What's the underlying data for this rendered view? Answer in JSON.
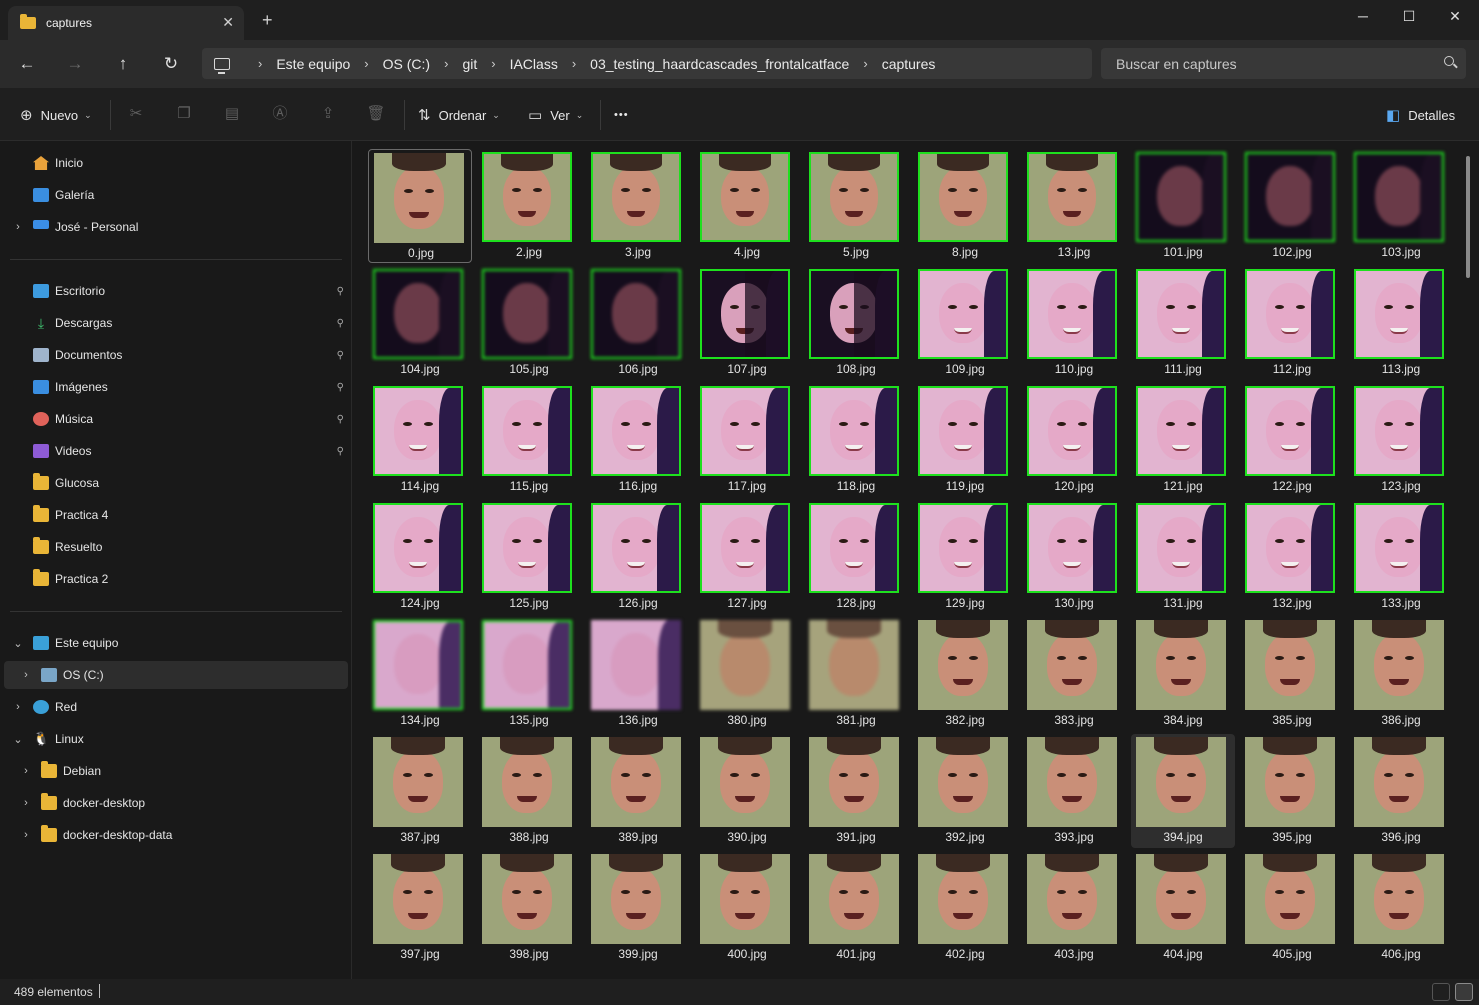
{
  "window": {
    "tab_title": "captures",
    "new_tab": "+",
    "close_tab": "✕",
    "minimize": "─",
    "maximize": "☐",
    "close": "✕"
  },
  "nav": {
    "back": "←",
    "forward": "→",
    "up": "↑",
    "refresh": "↻"
  },
  "breadcrumb": [
    "Este equipo",
    "OS (C:)",
    "git",
    "IAClass",
    "03_testing_haardcascades_frontalcatface",
    "captures"
  ],
  "search": {
    "placeholder": "Buscar en captures"
  },
  "commandbar": {
    "new_label": "Nuevo",
    "sort_label": "Ordenar",
    "view_label": "Ver",
    "more_label": "•••",
    "details_label": "Detalles",
    "icons": [
      "cut-icon",
      "copy-icon",
      "paste-icon",
      "rename-icon",
      "share-icon",
      "delete-icon"
    ]
  },
  "sidebar": {
    "top": [
      {
        "label": "Inicio",
        "icon": "home-icon"
      },
      {
        "label": "Galería",
        "icon": "gallery-icon"
      },
      {
        "label": "José - Personal",
        "icon": "onedrive-icon",
        "expandable": true
      }
    ],
    "quick": [
      {
        "label": "Escritorio",
        "icon": "desktop-icon",
        "pinned": true
      },
      {
        "label": "Descargas",
        "icon": "downloads-icon",
        "pinned": true
      },
      {
        "label": "Documentos",
        "icon": "documents-icon",
        "pinned": true
      },
      {
        "label": "Imágenes",
        "icon": "pictures-icon",
        "pinned": true
      },
      {
        "label": "Música",
        "icon": "music-icon",
        "pinned": true
      },
      {
        "label": "Videos",
        "icon": "videos-icon",
        "pinned": true
      },
      {
        "label": "Glucosa",
        "icon": "folder-icon"
      },
      {
        "label": "Practica 4",
        "icon": "folder-icon"
      },
      {
        "label": "Resuelto",
        "icon": "folder-icon"
      },
      {
        "label": "Practica 2",
        "icon": "folder-icon"
      }
    ],
    "tree": [
      {
        "label": "Este equipo",
        "icon": "pc-icon",
        "expanded": true,
        "level": 0
      },
      {
        "label": "OS (C:)",
        "icon": "drive-icon",
        "level": 1,
        "selected": true
      },
      {
        "label": "Red",
        "icon": "network-icon",
        "level": 0
      },
      {
        "label": "Linux",
        "icon": "linux-icon",
        "expanded": true,
        "level": 0
      },
      {
        "label": "Debian",
        "icon": "folder-icon",
        "level": 1
      },
      {
        "label": "docker-desktop",
        "icon": "folder-icon",
        "level": 1
      },
      {
        "label": "docker-desktop-data",
        "icon": "folder-icon",
        "level": 1
      }
    ],
    "pin_glyph": "📌",
    "expand_glyph": "›",
    "collapse_glyph": "⌄"
  },
  "files": [
    {
      "name": "0.jpg",
      "face": "man",
      "frame": false,
      "focus": true
    },
    {
      "name": "2.jpg",
      "face": "man",
      "frame": true
    },
    {
      "name": "3.jpg",
      "face": "man",
      "frame": true
    },
    {
      "name": "4.jpg",
      "face": "man",
      "frame": true
    },
    {
      "name": "5.jpg",
      "face": "man",
      "frame": true
    },
    {
      "name": "8.jpg",
      "face": "man",
      "frame": true
    },
    {
      "name": "13.jpg",
      "face": "man",
      "frame": true
    },
    {
      "name": "101.jpg",
      "face": "dark",
      "frame": true
    },
    {
      "name": "102.jpg",
      "face": "dark",
      "frame": true
    },
    {
      "name": "103.jpg",
      "face": "dark",
      "frame": true
    },
    {
      "name": "104.jpg",
      "face": "dark",
      "frame": true
    },
    {
      "name": "105.jpg",
      "face": "dark",
      "frame": true
    },
    {
      "name": "106.jpg",
      "face": "dark",
      "frame": true
    },
    {
      "name": "107.jpg",
      "face": "split",
      "frame": true
    },
    {
      "name": "108.jpg",
      "face": "split",
      "frame": true
    },
    {
      "name": "109.jpg",
      "face": "woman",
      "frame": true
    },
    {
      "name": "110.jpg",
      "face": "woman",
      "frame": true
    },
    {
      "name": "111.jpg",
      "face": "woman",
      "frame": true
    },
    {
      "name": "112.jpg",
      "face": "woman",
      "frame": true
    },
    {
      "name": "113.jpg",
      "face": "woman",
      "frame": true
    },
    {
      "name": "114.jpg",
      "face": "woman",
      "frame": true
    },
    {
      "name": "115.jpg",
      "face": "woman",
      "frame": true
    },
    {
      "name": "116.jpg",
      "face": "woman",
      "frame": true
    },
    {
      "name": "117.jpg",
      "face": "woman",
      "frame": true
    },
    {
      "name": "118.jpg",
      "face": "woman",
      "frame": true
    },
    {
      "name": "119.jpg",
      "face": "woman",
      "frame": true
    },
    {
      "name": "120.jpg",
      "face": "woman",
      "frame": true
    },
    {
      "name": "121.jpg",
      "face": "woman",
      "frame": true
    },
    {
      "name": "122.jpg",
      "face": "woman",
      "frame": true
    },
    {
      "name": "123.jpg",
      "face": "woman",
      "frame": true
    },
    {
      "name": "124.jpg",
      "face": "woman",
      "frame": true
    },
    {
      "name": "125.jpg",
      "face": "woman",
      "frame": true
    },
    {
      "name": "126.jpg",
      "face": "woman",
      "frame": true
    },
    {
      "name": "127.jpg",
      "face": "woman",
      "frame": true
    },
    {
      "name": "128.jpg",
      "face": "woman",
      "frame": true
    },
    {
      "name": "129.jpg",
      "face": "woman",
      "frame": true
    },
    {
      "name": "130.jpg",
      "face": "woman",
      "frame": true
    },
    {
      "name": "131.jpg",
      "face": "woman",
      "frame": true
    },
    {
      "name": "132.jpg",
      "face": "woman",
      "frame": true
    },
    {
      "name": "133.jpg",
      "face": "woman",
      "frame": true
    },
    {
      "name": "134.jpg",
      "face": "woman-blur",
      "frame": true
    },
    {
      "name": "135.jpg",
      "face": "woman-blur",
      "frame": true
    },
    {
      "name": "136.jpg",
      "face": "woman-blur",
      "frame": false
    },
    {
      "name": "380.jpg",
      "face": "man-blur",
      "frame": false
    },
    {
      "name": "381.jpg",
      "face": "man-blur",
      "frame": false
    },
    {
      "name": "382.jpg",
      "face": "man",
      "frame": false
    },
    {
      "name": "383.jpg",
      "face": "man",
      "frame": false
    },
    {
      "name": "384.jpg",
      "face": "man",
      "frame": false
    },
    {
      "name": "385.jpg",
      "face": "man",
      "frame": false
    },
    {
      "name": "386.jpg",
      "face": "man",
      "frame": false
    },
    {
      "name": "387.jpg",
      "face": "man",
      "frame": false
    },
    {
      "name": "388.jpg",
      "face": "man",
      "frame": false
    },
    {
      "name": "389.jpg",
      "face": "man",
      "frame": false
    },
    {
      "name": "390.jpg",
      "face": "man",
      "frame": false
    },
    {
      "name": "391.jpg",
      "face": "man",
      "frame": false
    },
    {
      "name": "392.jpg",
      "face": "man",
      "frame": false
    },
    {
      "name": "393.jpg",
      "face": "man",
      "frame": false
    },
    {
      "name": "394.jpg",
      "face": "man",
      "frame": false,
      "selected": true
    },
    {
      "name": "395.jpg",
      "face": "man",
      "frame": false
    },
    {
      "name": "396.jpg",
      "face": "man",
      "frame": false
    },
    {
      "name": "397.jpg",
      "face": "man",
      "frame": false
    },
    {
      "name": "398.jpg",
      "face": "man",
      "frame": false
    },
    {
      "name": "399.jpg",
      "face": "man",
      "frame": false
    },
    {
      "name": "400.jpg",
      "face": "man",
      "frame": false
    },
    {
      "name": "401.jpg",
      "face": "man",
      "frame": false
    },
    {
      "name": "402.jpg",
      "face": "man",
      "frame": false
    },
    {
      "name": "403.jpg",
      "face": "man",
      "frame": false
    },
    {
      "name": "404.jpg",
      "face": "man",
      "frame": false
    },
    {
      "name": "405.jpg",
      "face": "man",
      "frame": false
    },
    {
      "name": "406.jpg",
      "face": "man",
      "frame": false
    }
  ],
  "status": {
    "item_count": "489 elementos"
  },
  "colors": {
    "detection_frame": "#1ee01e",
    "folder": "#e9b537",
    "background": "#191919"
  }
}
